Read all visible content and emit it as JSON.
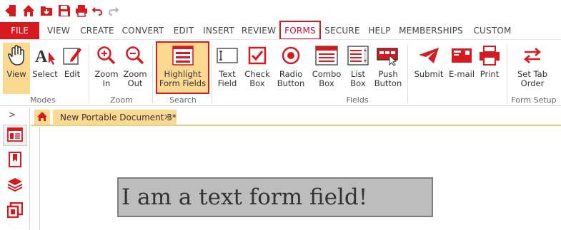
{
  "quick_access": {
    "icons": [
      "exit-icon",
      "home-icon",
      "import-icon",
      "save-icon",
      "print-icon",
      "undo-icon",
      "redo-icon"
    ]
  },
  "menu": {
    "file_label": "FILE",
    "tabs": [
      "VIEW",
      "CREATE",
      "CONVERT",
      "EDIT",
      "INSERT",
      "REVIEW",
      "FORMS",
      "SECURE",
      "HELP",
      "MEMBERSHIPS",
      "CUSTOM"
    ],
    "active_tab": "FORMS"
  },
  "ribbon": {
    "modes": {
      "group_label": "Modes",
      "view": "View",
      "select": "Select",
      "edit": "Edit"
    },
    "zoom": {
      "group_label": "Zoom",
      "zoom_in": "Zoom\nIn",
      "zoom_out": "Zoom\nOut"
    },
    "search": {
      "group_label": "Search",
      "highlight": "Highlight\nForm Fields"
    },
    "fields": {
      "group_label": "Fields",
      "text_field": "Text\nField",
      "check_box": "Check\nBox",
      "radio_button": "Radio\nButton",
      "combo_box": "Combo\nBox",
      "list_box": "List\nBox",
      "push_button": "Push\nButton",
      "submit": "Submit",
      "email": "E-mail",
      "print": "Print"
    },
    "form_setup": {
      "group_label": "Form Setup",
      "set_tab_order": "Set Tab\nOrder"
    }
  },
  "document": {
    "tab_title": "New Portable Document 3*",
    "close_glyph": "×",
    "text_field_value": "I am a text form field!"
  },
  "sidebar": {
    "expand_glyph": ">"
  },
  "colors": {
    "brand_red": "#d71920",
    "selected_bg": "#fbd990",
    "field_bg": "#bdbdbd"
  }
}
